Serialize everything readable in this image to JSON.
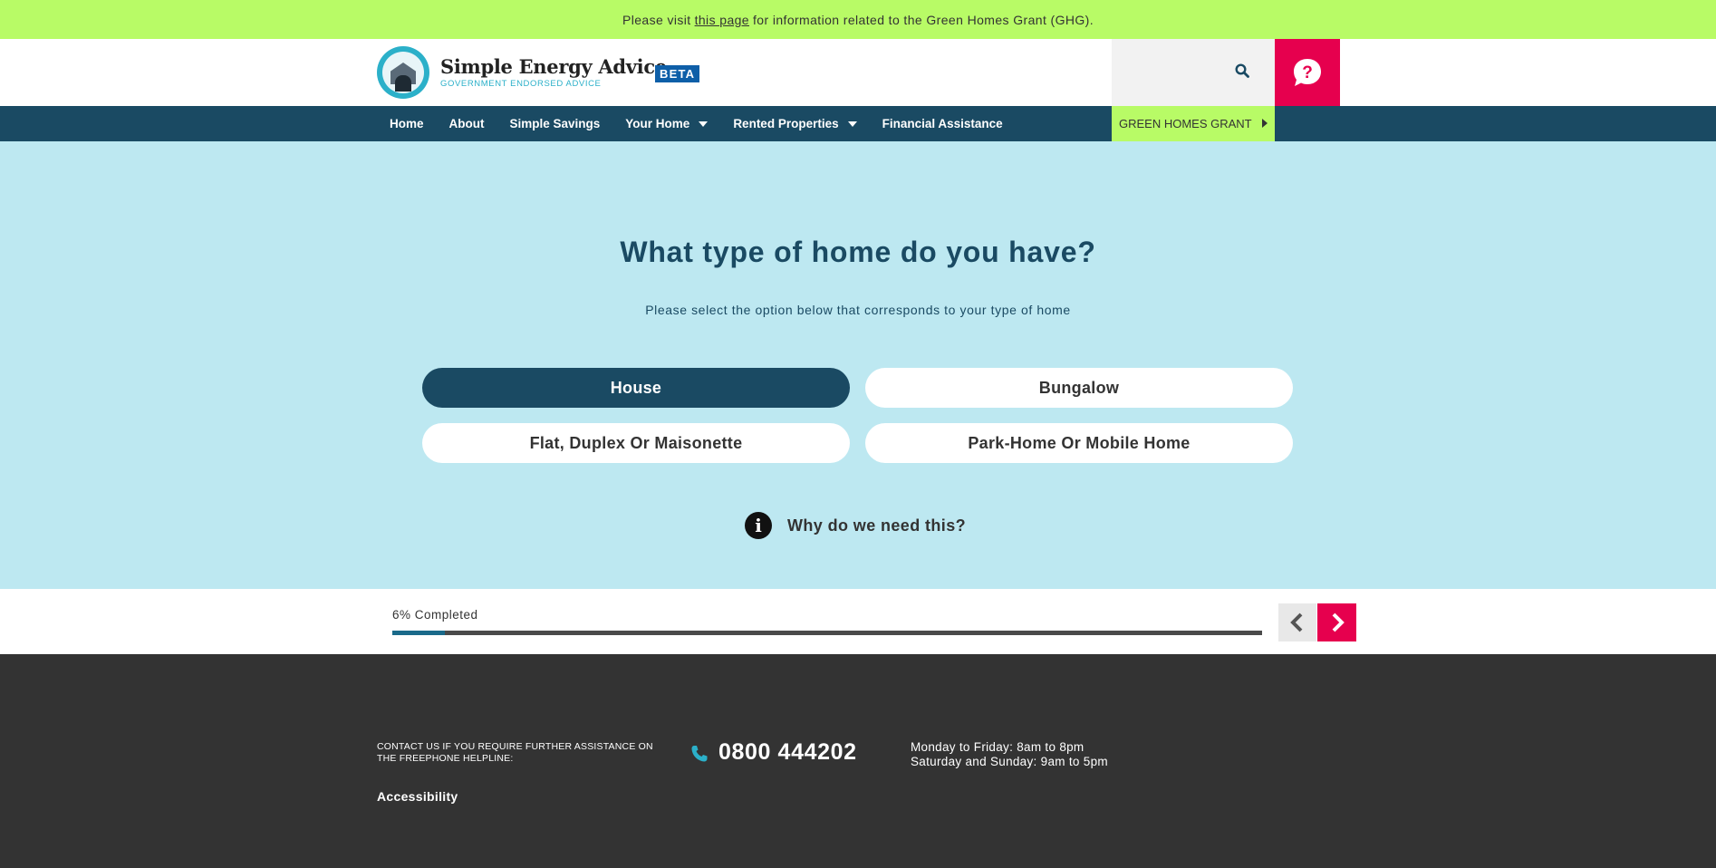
{
  "banner": {
    "prefix": "Please visit ",
    "link": "this page",
    "suffix": " for information related to the Green Homes Grant (GHG)."
  },
  "header": {
    "brand_title": "Simple Energy Advice",
    "brand_subtitle": "GOVERNMENT ENDORSED ADVICE",
    "badge": "BETA",
    "search_icon": "search-icon",
    "help_icon": "help-chat-icon"
  },
  "nav": {
    "items": [
      {
        "label": "Home",
        "dropdown": false
      },
      {
        "label": "About",
        "dropdown": false
      },
      {
        "label": "Simple Savings",
        "dropdown": false
      },
      {
        "label": "Your Home",
        "dropdown": true
      },
      {
        "label": "Rented Properties",
        "dropdown": true
      },
      {
        "label": "Financial Assistance",
        "dropdown": false
      }
    ],
    "ghg_label": "GREEN HOMES GRANT"
  },
  "question": {
    "title": "What type of home do you have?",
    "subtitle": "Please select the option below that corresponds to your type of home",
    "options": [
      {
        "label": "House",
        "selected": true
      },
      {
        "label": "Bungalow",
        "selected": false
      },
      {
        "label": "Flat, Duplex Or Maisonette",
        "selected": false
      },
      {
        "label": "Park-Home Or Mobile Home",
        "selected": false
      }
    ],
    "why_label": "Why do we need this?",
    "why_icon": "info-icon"
  },
  "progress": {
    "label": "6% Completed",
    "percent": 6
  },
  "footer": {
    "contact_text": "CONTACT US IF YOU REQUIRE FURTHER ASSISTANCE ON THE FREEPHONE HELPLINE:",
    "phone": "0800 444202",
    "hours_weekday": "Monday to Friday: 8am to 8pm",
    "hours_weekend": "Saturday and Sunday: 9am to 5pm",
    "accessibility": "Accessibility"
  },
  "colors": {
    "navy": "#1a4a63",
    "lime": "#b8fb66",
    "pink": "#e6004e",
    "light_blue": "#bde8f1",
    "footer_bg": "#333333",
    "teal": "#2bb0c9"
  }
}
